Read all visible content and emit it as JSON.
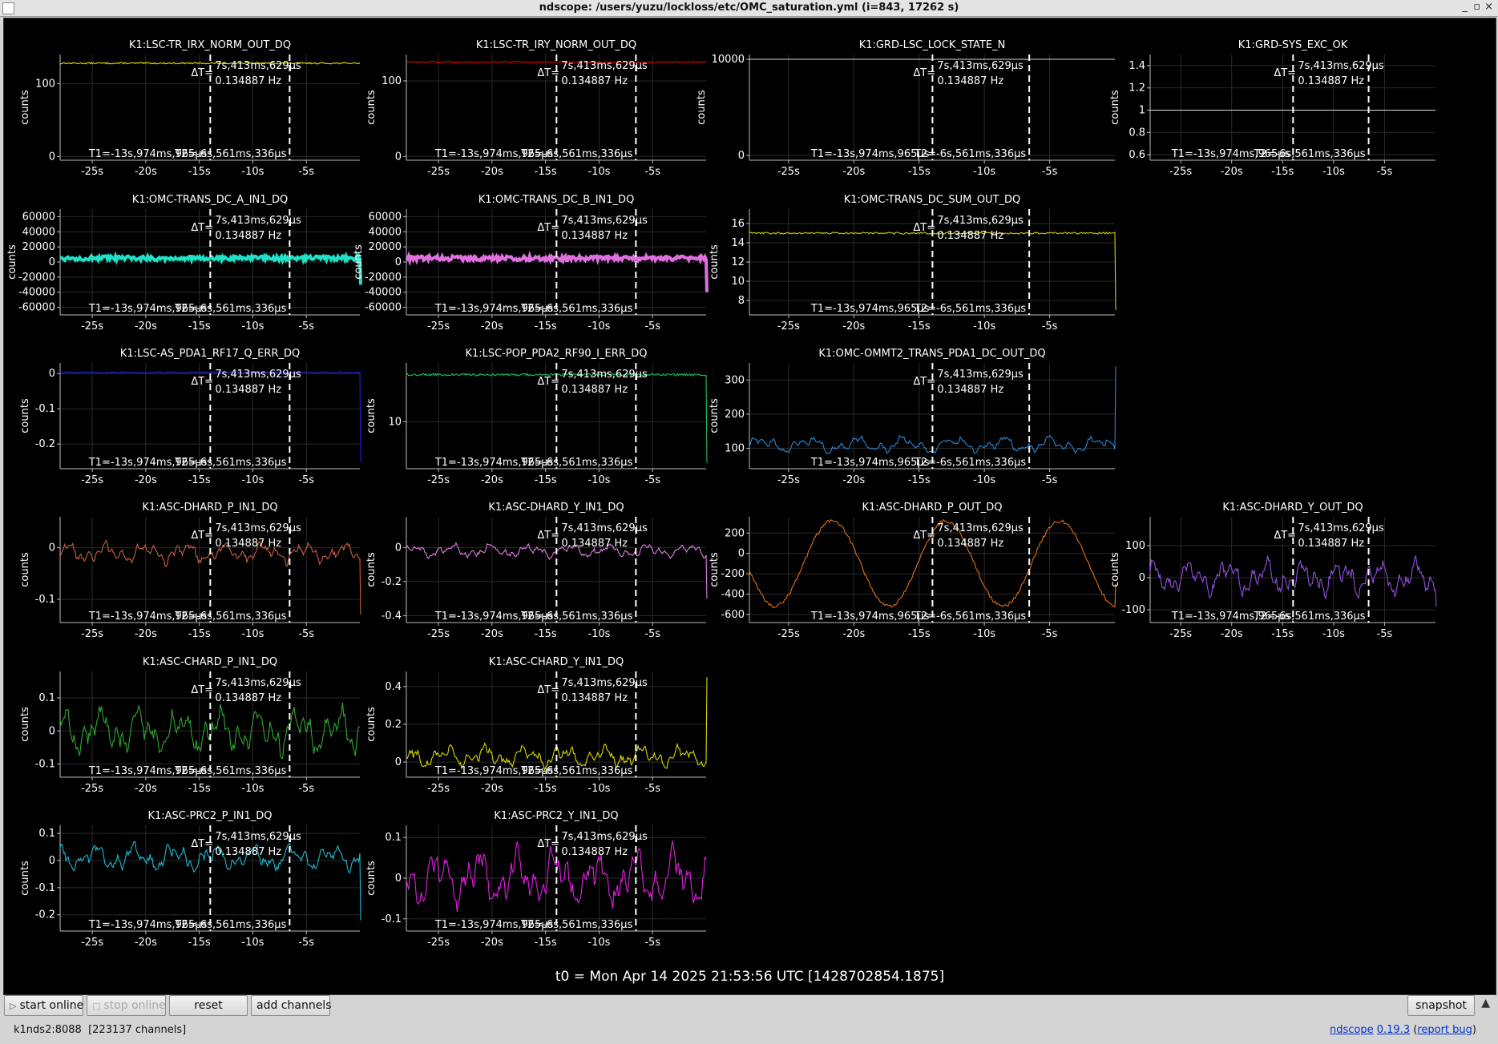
{
  "window": {
    "title": "ndscope: /users/yuzu/lockloss/etc/OMC_saturation.yml (i=843, 17262 s)",
    "minimize_glyph": "_",
    "maximize_glyph": "▫",
    "close_glyph": "×"
  },
  "colors": {
    "background": "#000000",
    "grid": "#2a2a2a",
    "axis": "#bbbbbb",
    "text": "#ffffff",
    "cursor": "#ffffff"
  },
  "cursor": {
    "delta_label": "ΔT=",
    "delta_value": "7s,413ms,629µs",
    "frequency": "0.134887 Hz",
    "t1_label": "T1=-13s,974ms,965µs",
    "t2_label": "T2=-6s,561ms,336µs",
    "t1_seconds": -13.975,
    "t2_seconds": -6.561
  },
  "plots": [
    {
      "title": "K1:LSC-TR_IRX_NORM_OUT_DQ",
      "ylabel": "counts",
      "color": "#e6e600",
      "yticks": [
        "100",
        "0"
      ],
      "ytick_values": [
        100,
        0
      ],
      "ylim": [
        -5,
        140
      ],
      "signal": {
        "kind": "flat",
        "level": 128,
        "noise": 1,
        "end_drop": 0
      }
    },
    {
      "title": "K1:LSC-TR_IRY_NORM_OUT_DQ",
      "ylabel": "counts",
      "color": "#e00000",
      "yticks": [
        "100",
        "0"
      ],
      "ytick_values": [
        100,
        0
      ],
      "ylim": [
        -5,
        135
      ],
      "signal": {
        "kind": "flat",
        "level": 125,
        "noise": 1,
        "end_drop": 0
      }
    },
    {
      "title": "K1:GRD-LSC_LOCK_STATE_N",
      "ylabel": "counts",
      "color": "#dddddd",
      "yticks": [
        "10000",
        "0"
      ],
      "ytick_values": [
        10000,
        0
      ],
      "ylim": [
        -500,
        10500
      ],
      "signal": {
        "kind": "flat",
        "level": 10000,
        "noise": 0,
        "end_drop": 0
      }
    },
    {
      "title": "K1:GRD-SYS_EXC_OK",
      "ylabel": "counts",
      "color": "#dddddd",
      "yticks": [
        "1.4",
        "1.2",
        "1",
        "0.8",
        "0.6"
      ],
      "ytick_values": [
        1.4,
        1.2,
        1,
        0.8,
        0.6
      ],
      "ylim": [
        0.55,
        1.5
      ],
      "signal": {
        "kind": "flat",
        "level": 1,
        "noise": 0,
        "end_drop": null
      }
    },
    {
      "title": "K1:OMC-TRANS_DC_A_IN1_DQ",
      "ylabel": "counts",
      "color": "#20e0c8",
      "yticks": [
        "60000",
        "40000",
        "20000",
        "0",
        "-20000",
        "-40000",
        "-60000"
      ],
      "ytick_values": [
        60000,
        40000,
        20000,
        0,
        -20000,
        -40000,
        -60000
      ],
      "ylim": [
        -70000,
        70000
      ],
      "signal": {
        "kind": "band",
        "level": 5000,
        "noise": 3000,
        "end_drop": -30000
      }
    },
    {
      "title": "K1:OMC-TRANS_DC_B_IN1_DQ",
      "ylabel": "counts",
      "color": "#e070e0",
      "yticks": [
        "60000",
        "40000",
        "20000",
        "0",
        "-20000",
        "-40000",
        "-60000"
      ],
      "ytick_values": [
        60000,
        40000,
        20000,
        0,
        -20000,
        -40000,
        -60000
      ],
      "ylim": [
        -70000,
        70000
      ],
      "signal": {
        "kind": "band",
        "level": 5000,
        "noise": 3000,
        "end_drop": -40000
      }
    },
    {
      "title": "K1:OMC-TRANS_DC_SUM_OUT_DQ",
      "ylabel": "counts",
      "color": "#e0d000",
      "yticks": [
        "16",
        "14",
        "12",
        "10",
        "8"
      ],
      "ytick_values": [
        16,
        14,
        12,
        10,
        8
      ],
      "ylim": [
        6.5,
        17.5
      ],
      "signal": {
        "kind": "flat",
        "level": 15,
        "noise": 0.1,
        "end_drop": 7
      }
    },
    null,
    {
      "title": "K1:LSC-AS_PDA1_RF17_Q_ERR_DQ",
      "ylabel": "counts",
      "color": "#2020e0",
      "yticks": [
        "0",
        "-0.1",
        "-0.2"
      ],
      "ytick_values": [
        0,
        -0.1,
        -0.2
      ],
      "ylim": [
        -0.27,
        0.03
      ],
      "signal": {
        "kind": "flat",
        "level": 0.003,
        "noise": 0.002,
        "end_drop": -0.25
      }
    },
    {
      "title": "K1:LSC-POP_PDA2_RF90_I_ERR_DQ",
      "ylabel": "counts",
      "color": "#20c060",
      "yticks": [
        "10"
      ],
      "ytick_values": [
        10
      ],
      "ylim": [
        2,
        20
      ],
      "signal": {
        "kind": "flat",
        "level": 18,
        "noise": 0.2,
        "end_drop": 3
      }
    },
    {
      "title": "K1:OMC-OMMT2_TRANS_PDA1_DC_OUT_DQ",
      "ylabel": "counts",
      "color": "#2888d8",
      "yticks": [
        "300",
        "200",
        "100"
      ],
      "ytick_values": [
        300,
        200,
        100
      ],
      "ylim": [
        40,
        350
      ],
      "signal": {
        "kind": "wave",
        "level": 110,
        "noise": 25,
        "end_drop": 340
      }
    },
    null,
    {
      "title": "K1:ASC-DHARD_P_IN1_DQ",
      "ylabel": "counts",
      "color": "#c86040",
      "yticks": [
        "0",
        "-0.1"
      ],
      "ytick_values": [
        0,
        -0.1
      ],
      "ylim": [
        -0.145,
        0.06
      ],
      "signal": {
        "kind": "wave",
        "level": -0.01,
        "noise": 0.02,
        "end_drop": -0.13
      }
    },
    {
      "title": "K1:ASC-DHARD_Y_IN1_DQ",
      "ylabel": "counts",
      "color": "#e080e0",
      "yticks": [
        "0",
        "-0.2",
        "-0.4"
      ],
      "ytick_values": [
        0,
        -0.2,
        -0.4
      ],
      "ylim": [
        -0.44,
        0.18
      ],
      "signal": {
        "kind": "wave",
        "level": -0.02,
        "noise": 0.04,
        "end_drop": -0.3
      }
    },
    {
      "title": "K1:ASC-DHARD_P_OUT_DQ",
      "ylabel": "counts",
      "color": "#e07010",
      "yticks": [
        "200",
        "0",
        "-200",
        "-400",
        "-600"
      ],
      "ytick_values": [
        200,
        0,
        -200,
        -400,
        -600
      ],
      "ylim": [
        -680,
        360
      ],
      "signal": {
        "kind": "sine",
        "level": -100,
        "noise": 420,
        "end_drop": -300
      }
    },
    {
      "title": "K1:ASC-DHARD_Y_OUT_DQ",
      "ylabel": "counts",
      "color": "#9050e0",
      "yticks": [
        "100",
        "0",
        "-100"
      ],
      "ytick_values": [
        100,
        0,
        -100
      ],
      "ylim": [
        -140,
        190
      ],
      "signal": {
        "kind": "wave",
        "level": 0,
        "noise": 55,
        "end_drop": -90
      }
    },
    {
      "title": "K1:ASC-CHARD_P_IN1_DQ",
      "ylabel": "counts",
      "color": "#30a830",
      "yticks": [
        "0.1",
        "0",
        "-0.1"
      ],
      "ytick_values": [
        0.1,
        0,
        -0.1
      ],
      "ylim": [
        -0.14,
        0.18
      ],
      "signal": {
        "kind": "wave",
        "level": 0,
        "noise": 0.07,
        "end_drop": 0
      }
    },
    {
      "title": "K1:ASC-CHARD_Y_IN1_DQ",
      "ylabel": "counts",
      "color": "#d8d800",
      "yticks": [
        "0.4",
        "0.2",
        "0"
      ],
      "ytick_values": [
        0.4,
        0.2,
        0
      ],
      "ylim": [
        -0.08,
        0.48
      ],
      "signal": {
        "kind": "wave",
        "level": 0.03,
        "noise": 0.06,
        "end_drop": 0.45
      }
    },
    null,
    null,
    {
      "title": "K1:ASC-PRC2_P_IN1_DQ",
      "ylabel": "counts",
      "color": "#20b8d0",
      "yticks": [
        "0.1",
        "0",
        "-0.1",
        "-0.2"
      ],
      "ytick_values": [
        0.1,
        0,
        -0.1,
        -0.2
      ],
      "ylim": [
        -0.26,
        0.13
      ],
      "signal": {
        "kind": "wave",
        "level": 0.01,
        "noise": 0.05,
        "end_drop": -0.22
      }
    },
    {
      "title": "K1:ASC-PRC2_Y_IN1_DQ",
      "ylabel": "counts",
      "color": "#e020e0",
      "yticks": [
        "0.1",
        "0",
        "-0.1"
      ],
      "ytick_values": [
        0.1,
        0,
        -0.1
      ],
      "ylim": [
        -0.13,
        0.13
      ],
      "signal": {
        "kind": "wave",
        "level": 0,
        "noise": 0.07,
        "end_drop": 0
      }
    },
    null,
    null
  ],
  "x_axis": {
    "ticks": [
      "-25s",
      "-20s",
      "-15s",
      "-10s",
      "-5s"
    ],
    "tick_values": [
      -25,
      -20,
      -15,
      -10,
      -5
    ],
    "xlim": [
      -28,
      0
    ]
  },
  "t0": "t0 = Mon Apr 14 2025 21:53:56 UTC [1428702854.1875]",
  "toolbar": {
    "start_online": "start online",
    "stop_online": "stop online",
    "reset": "reset",
    "add_channels": "add channels",
    "snapshot": "snapshot",
    "play_glyph": "▷",
    "stop_glyph": "□",
    "collapse_glyph": "▲"
  },
  "status": {
    "server": "k1nds2:8088",
    "channels": "[223137 channels]",
    "app_name": "ndscope",
    "version": "0.19.3",
    "report_bug": "report bug"
  }
}
